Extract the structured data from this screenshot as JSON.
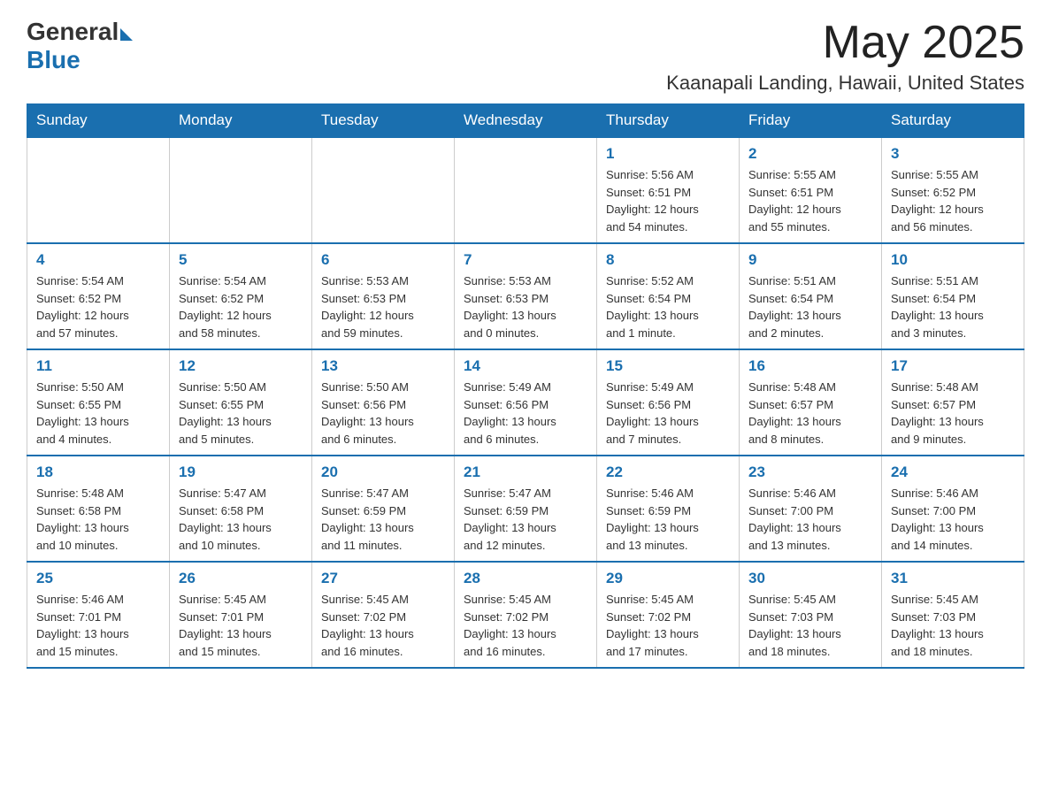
{
  "header": {
    "logo_general": "General",
    "logo_blue": "Blue",
    "month_title": "May 2025",
    "location": "Kaanapali Landing, Hawaii, United States"
  },
  "days_of_week": [
    "Sunday",
    "Monday",
    "Tuesday",
    "Wednesday",
    "Thursday",
    "Friday",
    "Saturday"
  ],
  "weeks": [
    [
      {
        "day": "",
        "info": ""
      },
      {
        "day": "",
        "info": ""
      },
      {
        "day": "",
        "info": ""
      },
      {
        "day": "",
        "info": ""
      },
      {
        "day": "1",
        "info": "Sunrise: 5:56 AM\nSunset: 6:51 PM\nDaylight: 12 hours\nand 54 minutes."
      },
      {
        "day": "2",
        "info": "Sunrise: 5:55 AM\nSunset: 6:51 PM\nDaylight: 12 hours\nand 55 minutes."
      },
      {
        "day": "3",
        "info": "Sunrise: 5:55 AM\nSunset: 6:52 PM\nDaylight: 12 hours\nand 56 minutes."
      }
    ],
    [
      {
        "day": "4",
        "info": "Sunrise: 5:54 AM\nSunset: 6:52 PM\nDaylight: 12 hours\nand 57 minutes."
      },
      {
        "day": "5",
        "info": "Sunrise: 5:54 AM\nSunset: 6:52 PM\nDaylight: 12 hours\nand 58 minutes."
      },
      {
        "day": "6",
        "info": "Sunrise: 5:53 AM\nSunset: 6:53 PM\nDaylight: 12 hours\nand 59 minutes."
      },
      {
        "day": "7",
        "info": "Sunrise: 5:53 AM\nSunset: 6:53 PM\nDaylight: 13 hours\nand 0 minutes."
      },
      {
        "day": "8",
        "info": "Sunrise: 5:52 AM\nSunset: 6:54 PM\nDaylight: 13 hours\nand 1 minute."
      },
      {
        "day": "9",
        "info": "Sunrise: 5:51 AM\nSunset: 6:54 PM\nDaylight: 13 hours\nand 2 minutes."
      },
      {
        "day": "10",
        "info": "Sunrise: 5:51 AM\nSunset: 6:54 PM\nDaylight: 13 hours\nand 3 minutes."
      }
    ],
    [
      {
        "day": "11",
        "info": "Sunrise: 5:50 AM\nSunset: 6:55 PM\nDaylight: 13 hours\nand 4 minutes."
      },
      {
        "day": "12",
        "info": "Sunrise: 5:50 AM\nSunset: 6:55 PM\nDaylight: 13 hours\nand 5 minutes."
      },
      {
        "day": "13",
        "info": "Sunrise: 5:50 AM\nSunset: 6:56 PM\nDaylight: 13 hours\nand 6 minutes."
      },
      {
        "day": "14",
        "info": "Sunrise: 5:49 AM\nSunset: 6:56 PM\nDaylight: 13 hours\nand 6 minutes."
      },
      {
        "day": "15",
        "info": "Sunrise: 5:49 AM\nSunset: 6:56 PM\nDaylight: 13 hours\nand 7 minutes."
      },
      {
        "day": "16",
        "info": "Sunrise: 5:48 AM\nSunset: 6:57 PM\nDaylight: 13 hours\nand 8 minutes."
      },
      {
        "day": "17",
        "info": "Sunrise: 5:48 AM\nSunset: 6:57 PM\nDaylight: 13 hours\nand 9 minutes."
      }
    ],
    [
      {
        "day": "18",
        "info": "Sunrise: 5:48 AM\nSunset: 6:58 PM\nDaylight: 13 hours\nand 10 minutes."
      },
      {
        "day": "19",
        "info": "Sunrise: 5:47 AM\nSunset: 6:58 PM\nDaylight: 13 hours\nand 10 minutes."
      },
      {
        "day": "20",
        "info": "Sunrise: 5:47 AM\nSunset: 6:59 PM\nDaylight: 13 hours\nand 11 minutes."
      },
      {
        "day": "21",
        "info": "Sunrise: 5:47 AM\nSunset: 6:59 PM\nDaylight: 13 hours\nand 12 minutes."
      },
      {
        "day": "22",
        "info": "Sunrise: 5:46 AM\nSunset: 6:59 PM\nDaylight: 13 hours\nand 13 minutes."
      },
      {
        "day": "23",
        "info": "Sunrise: 5:46 AM\nSunset: 7:00 PM\nDaylight: 13 hours\nand 13 minutes."
      },
      {
        "day": "24",
        "info": "Sunrise: 5:46 AM\nSunset: 7:00 PM\nDaylight: 13 hours\nand 14 minutes."
      }
    ],
    [
      {
        "day": "25",
        "info": "Sunrise: 5:46 AM\nSunset: 7:01 PM\nDaylight: 13 hours\nand 15 minutes."
      },
      {
        "day": "26",
        "info": "Sunrise: 5:45 AM\nSunset: 7:01 PM\nDaylight: 13 hours\nand 15 minutes."
      },
      {
        "day": "27",
        "info": "Sunrise: 5:45 AM\nSunset: 7:02 PM\nDaylight: 13 hours\nand 16 minutes."
      },
      {
        "day": "28",
        "info": "Sunrise: 5:45 AM\nSunset: 7:02 PM\nDaylight: 13 hours\nand 16 minutes."
      },
      {
        "day": "29",
        "info": "Sunrise: 5:45 AM\nSunset: 7:02 PM\nDaylight: 13 hours\nand 17 minutes."
      },
      {
        "day": "30",
        "info": "Sunrise: 5:45 AM\nSunset: 7:03 PM\nDaylight: 13 hours\nand 18 minutes."
      },
      {
        "day": "31",
        "info": "Sunrise: 5:45 AM\nSunset: 7:03 PM\nDaylight: 13 hours\nand 18 minutes."
      }
    ]
  ]
}
